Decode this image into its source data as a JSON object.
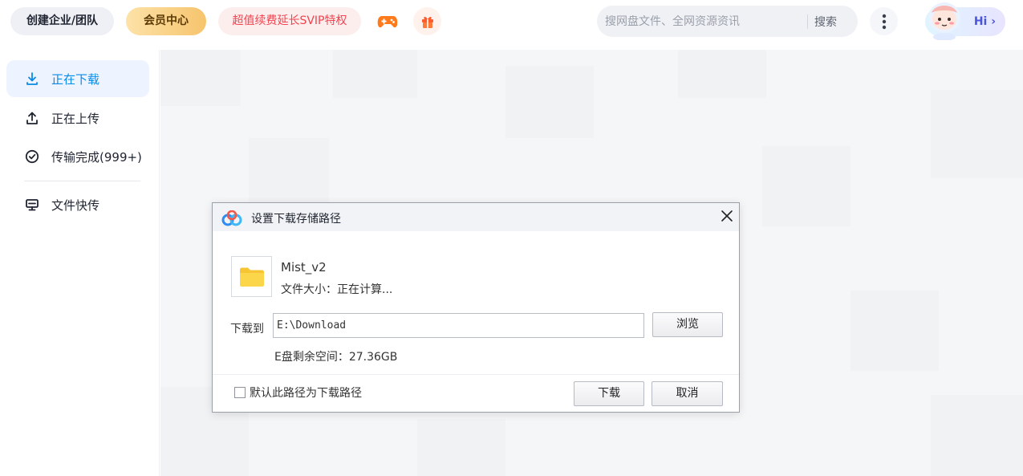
{
  "header": {
    "enterprise_label": "创建企业/团队",
    "vip_label": "会员中心",
    "svip_label": "超值续费延长SVIP特权",
    "game_icon": "gamepad-icon",
    "gift_icon": "gift-icon",
    "search": {
      "placeholder": "搜网盘文件、全网资源资讯",
      "button_label": "搜索"
    },
    "more_icon": "more-vertical-icon",
    "hi_label": "Hi ›"
  },
  "sidebar": {
    "items": [
      {
        "label": "正在下载",
        "icon": "download-icon",
        "active": true
      },
      {
        "label": "正在上传",
        "icon": "upload-icon",
        "active": false
      },
      {
        "label": "传输完成(999+)",
        "icon": "check-circle-icon",
        "active": false
      },
      {
        "label": "文件快传",
        "icon": "monitor-icon",
        "active": false
      }
    ]
  },
  "dialog": {
    "title": "设置下载存储路径",
    "file_name": "Mist_v2",
    "file_size": "文件大小：正在计算...",
    "path_label": "下载到",
    "path_value": "E:\\Download",
    "browse_label": "浏览",
    "free_space": "E盘剩余空间：27.36GB",
    "default_checkbox_label": "默认此路径为下载路径",
    "default_checked": false,
    "download_label": "下载",
    "cancel_label": "取消"
  },
  "colors": {
    "accent": "#0a8ae6",
    "svip_text": "#f0434f",
    "vip_gradient_start": "#fde2a8",
    "vip_gradient_end": "#f6c46d"
  }
}
